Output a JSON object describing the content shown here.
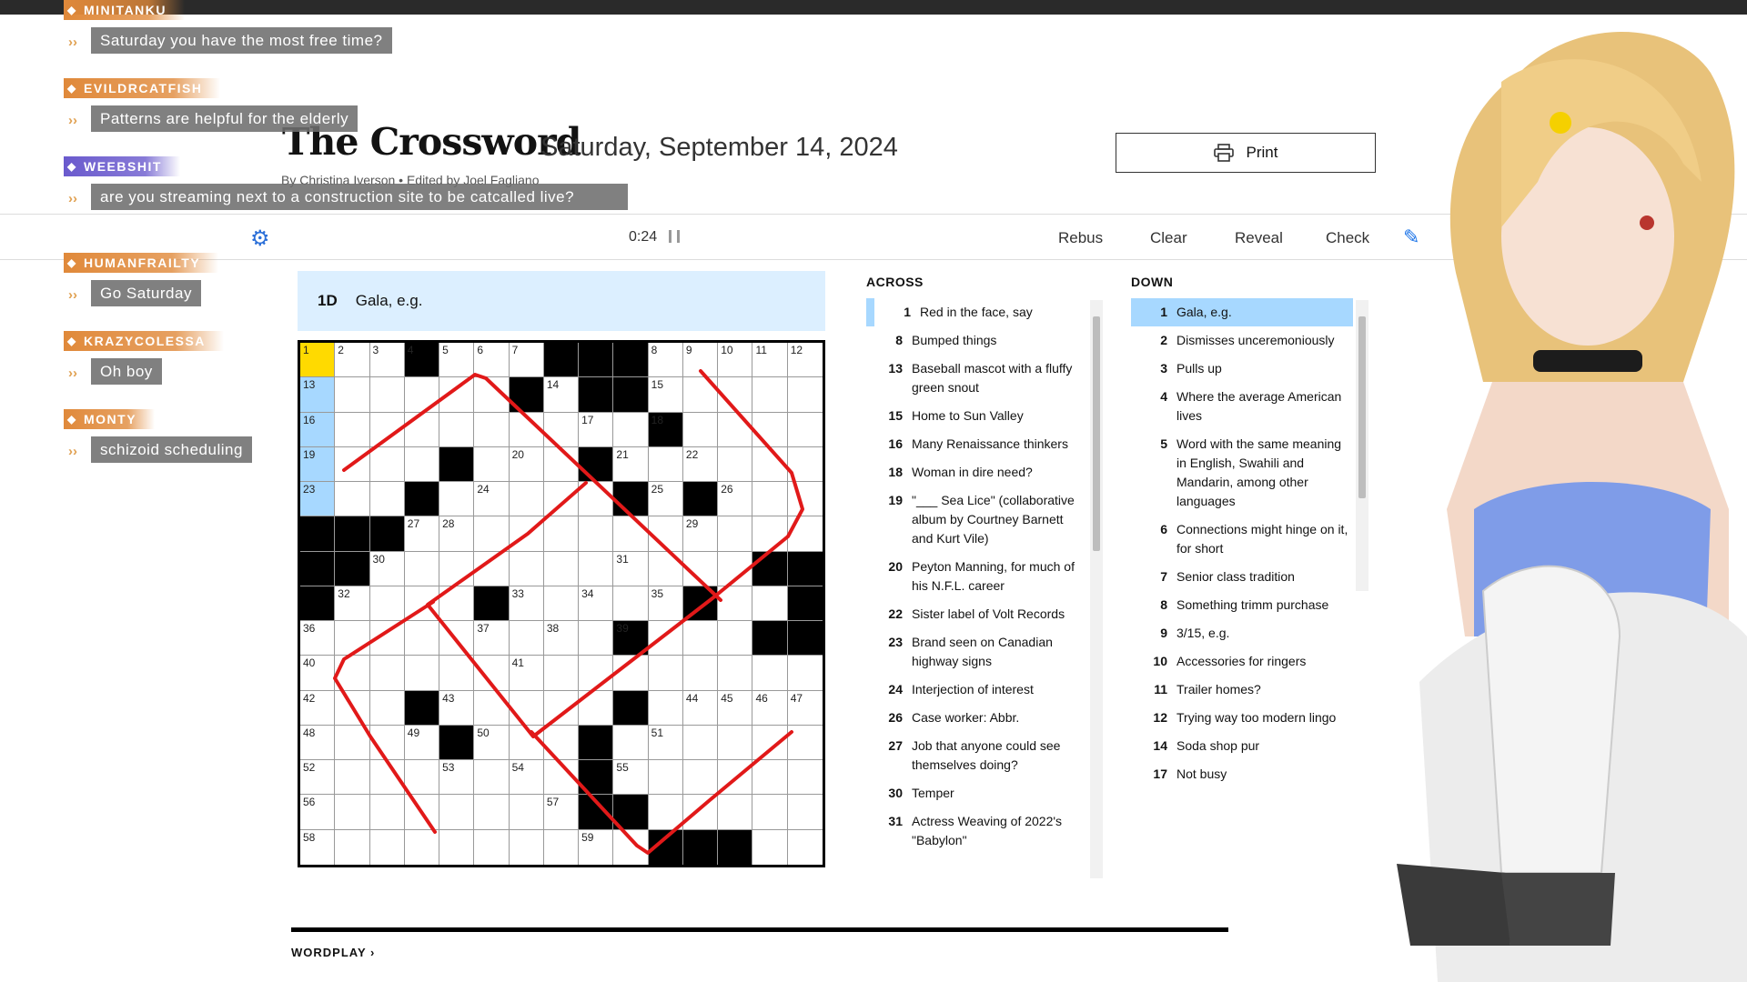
{
  "puzzle": {
    "title": "The Crossword",
    "date": "Saturday, September 14, 2024",
    "byline": "By Christina Iverson  •  Edited by Joel Fagliano",
    "print_label": "Print",
    "timer": "0:24",
    "toolbar": {
      "rebus": "Rebus",
      "clear": "Clear",
      "reveal": "Reveal",
      "check": "Check"
    },
    "current_clue": {
      "number": "1D",
      "text": "Gala, e.g."
    },
    "across_label": "ACROSS",
    "down_label": "DOWN",
    "across": [
      {
        "n": "1",
        "t": "Red in the face, say"
      },
      {
        "n": "8",
        "t": "Bumped things"
      },
      {
        "n": "13",
        "t": "Baseball mascot with a fluffy green snout"
      },
      {
        "n": "15",
        "t": "Home to Sun Valley"
      },
      {
        "n": "16",
        "t": "Many Renaissance thinkers"
      },
      {
        "n": "18",
        "t": "Woman in dire need?"
      },
      {
        "n": "19",
        "t": "\"___ Sea Lice\" (collaborative album by Courtney Barnett and Kurt Vile)"
      },
      {
        "n": "20",
        "t": "Peyton Manning, for much of his N.F.L. career"
      },
      {
        "n": "22",
        "t": "Sister label of Volt Records"
      },
      {
        "n": "23",
        "t": "Brand seen on Canadian highway signs"
      },
      {
        "n": "24",
        "t": "Interjection of interest"
      },
      {
        "n": "26",
        "t": "Case worker: Abbr."
      },
      {
        "n": "27",
        "t": "Job that anyone could see themselves doing?"
      },
      {
        "n": "30",
        "t": "Temper"
      },
      {
        "n": "31",
        "t": "Actress Weaving of 2022's \"Babylon\""
      }
    ],
    "down": [
      {
        "n": "1",
        "t": "Gala, e.g."
      },
      {
        "n": "2",
        "t": "Dismisses unceremoniously"
      },
      {
        "n": "3",
        "t": "Pulls up"
      },
      {
        "n": "4",
        "t": "Where the average American lives"
      },
      {
        "n": "5",
        "t": "Word with the same meaning in English, Swahili and Mandarin, among other languages"
      },
      {
        "n": "6",
        "t": "Connections might hinge on it, for short"
      },
      {
        "n": "7",
        "t": "Senior class tradition"
      },
      {
        "n": "8",
        "t": "Something trimm purchase"
      },
      {
        "n": "9",
        "t": "3/15, e.g."
      },
      {
        "n": "10",
        "t": "Accessories for ringers"
      },
      {
        "n": "11",
        "t": "Trailer homes?"
      },
      {
        "n": "12",
        "t": "Trying way too modern lingo"
      },
      {
        "n": "14",
        "t": "Soda shop pur"
      },
      {
        "n": "17",
        "t": "Not busy"
      }
    ],
    "wordplay": "WORDPLAY ›"
  },
  "grid": {
    "size": 15,
    "rows": [
      "...#...###.....",
      "......#.##.....",
      "..........#....",
      "....#...#......",
      "...#.....#.#...",
      "###............",
      "##...........##",
      "#....#.....#..#",
      ".........#...##",
      "...............",
      "...#.....#.....",
      "....#...#......",
      "........#......",
      "........##.....",
      "..........###.."
    ],
    "numbers": [
      [
        0,
        0,
        "1"
      ],
      [
        0,
        1,
        "2"
      ],
      [
        0,
        2,
        "3"
      ],
      [
        0,
        3,
        "4"
      ],
      [
        0,
        4,
        "5"
      ],
      [
        0,
        5,
        "6"
      ],
      [
        0,
        6,
        "7"
      ],
      [
        0,
        10,
        "8"
      ],
      [
        0,
        11,
        "9"
      ],
      [
        0,
        12,
        "10"
      ],
      [
        0,
        13,
        "11"
      ],
      [
        0,
        14,
        "12"
      ],
      [
        1,
        0,
        "13"
      ],
      [
        1,
        7,
        "14"
      ],
      [
        1,
        10,
        "15"
      ],
      [
        2,
        0,
        "16"
      ],
      [
        2,
        8,
        "17"
      ],
      [
        2,
        10,
        "18"
      ],
      [
        3,
        0,
        "19"
      ],
      [
        3,
        6,
        "20"
      ],
      [
        3,
        9,
        "21"
      ],
      [
        3,
        11,
        "22"
      ],
      [
        4,
        0,
        "23"
      ],
      [
        4,
        5,
        "24"
      ],
      [
        4,
        10,
        "25"
      ],
      [
        4,
        12,
        "26"
      ],
      [
        5,
        3,
        "27"
      ],
      [
        5,
        4,
        "28"
      ],
      [
        5,
        11,
        "29"
      ],
      [
        6,
        2,
        "30"
      ],
      [
        6,
        9,
        "31"
      ],
      [
        7,
        1,
        "32"
      ],
      [
        7,
        6,
        "33"
      ],
      [
        7,
        8,
        "34"
      ],
      [
        7,
        10,
        "35"
      ],
      [
        8,
        0,
        "36"
      ],
      [
        8,
        5,
        "37"
      ],
      [
        8,
        7,
        "38"
      ],
      [
        8,
        9,
        "39"
      ],
      [
        9,
        0,
        "40"
      ],
      [
        9,
        6,
        "41"
      ],
      [
        10,
        0,
        "42"
      ],
      [
        10,
        4,
        "43"
      ],
      [
        10,
        11,
        "44"
      ],
      [
        10,
        12,
        "45"
      ],
      [
        10,
        13,
        "46"
      ],
      [
        10,
        14,
        "47"
      ],
      [
        11,
        0,
        "48"
      ],
      [
        11,
        3,
        "49"
      ],
      [
        11,
        5,
        "50"
      ],
      [
        11,
        10,
        "51"
      ],
      [
        12,
        0,
        "52"
      ],
      [
        12,
        4,
        "53"
      ],
      [
        12,
        6,
        "54"
      ],
      [
        12,
        9,
        "55"
      ],
      [
        13,
        0,
        "56"
      ],
      [
        13,
        7,
        "57"
      ],
      [
        14,
        0,
        "58"
      ],
      [
        14,
        8,
        "59"
      ]
    ],
    "selected": [
      0,
      0
    ],
    "highlighted_column": 0,
    "highlighted_rows": [
      1,
      2,
      3,
      4
    ]
  },
  "chat": [
    {
      "user": "MINITANKU",
      "color": "#e0893a",
      "msg": "Saturday you have the most free time?"
    },
    {
      "user": "EVILDRCATFISH",
      "color": "#e0893a",
      "msg": "Patterns are helpful for the elderly"
    },
    {
      "user": "WEEBSHIT",
      "color": "#6a5acd",
      "msg": "are you streaming next to a construction site to be catcalled live?"
    },
    {
      "user": "HUMANFRAILTY",
      "color": "#e0893a",
      "msg": "Go Saturday"
    },
    {
      "user": "KRAZYCOLESSA",
      "color": "#e0893a",
      "msg": "Oh boy"
    },
    {
      "user": "MONTY",
      "color": "#e0893a",
      "msg": "schizoid scheduling"
    }
  ],
  "icons": {
    "print": "printer-icon",
    "pause": "pause-icon",
    "pencil": "pencil-icon",
    "settings": "gear-icon"
  }
}
